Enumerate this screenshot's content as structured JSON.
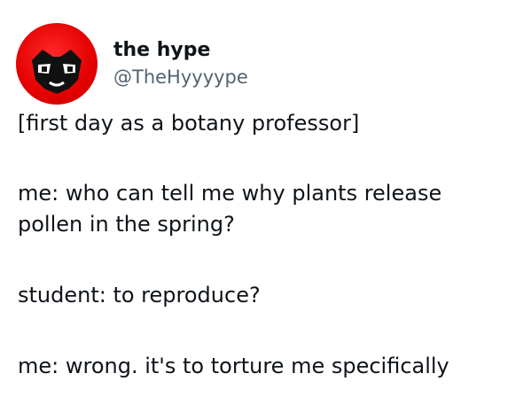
{
  "author": {
    "display_name": "the hype",
    "handle": "@TheHyyyype",
    "avatar_icon": "red-devil-face-icon"
  },
  "tweet": {
    "lines": [
      "[first day as a botany professor]",
      "me: who can tell me why plants release",
      "pollen in the spring?",
      "student: to reproduce?",
      "me: wrong. it's to torture me specifically"
    ]
  },
  "colors": {
    "text": "#0f1419",
    "handle": "#536471",
    "avatar": "#e30000"
  }
}
